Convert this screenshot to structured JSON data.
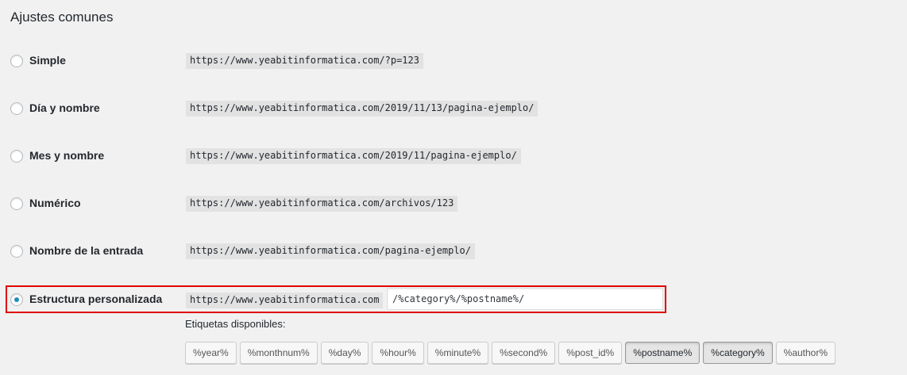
{
  "section": {
    "title": "Ajustes comunes"
  },
  "options": [
    {
      "label": "Simple",
      "url": "https://www.yeabitinformatica.com/?p=123",
      "checked": false
    },
    {
      "label": "Día y nombre",
      "url": "https://www.yeabitinformatica.com/2019/11/13/pagina-ejemplo/",
      "checked": false
    },
    {
      "label": "Mes y nombre",
      "url": "https://www.yeabitinformatica.com/2019/11/pagina-ejemplo/",
      "checked": false
    },
    {
      "label": "Numérico",
      "url": "https://www.yeabitinformatica.com/archivos/123",
      "checked": false
    },
    {
      "label": "Nombre de la entrada",
      "url": "https://www.yeabitinformatica.com/pagina-ejemplo/",
      "checked": false
    }
  ],
  "custom": {
    "label": "Estructura personalizada",
    "base_url": "https://www.yeabitinformatica.com",
    "structure_value": "/%category%/%postname%/",
    "checked": true
  },
  "tags": {
    "label": "Etiquetas disponibles:",
    "items": [
      {
        "label": "%year%",
        "active": false
      },
      {
        "label": "%monthnum%",
        "active": false
      },
      {
        "label": "%day%",
        "active": false
      },
      {
        "label": "%hour%",
        "active": false
      },
      {
        "label": "%minute%",
        "active": false
      },
      {
        "label": "%second%",
        "active": false
      },
      {
        "label": "%post_id%",
        "active": false
      },
      {
        "label": "%postname%",
        "active": true
      },
      {
        "label": "%category%",
        "active": true
      },
      {
        "label": "%author%",
        "active": false
      }
    ]
  },
  "colors": {
    "highlight_border": "#e00000",
    "radio_checked": "#1e8cbe",
    "code_background": "#e2e2e2"
  }
}
